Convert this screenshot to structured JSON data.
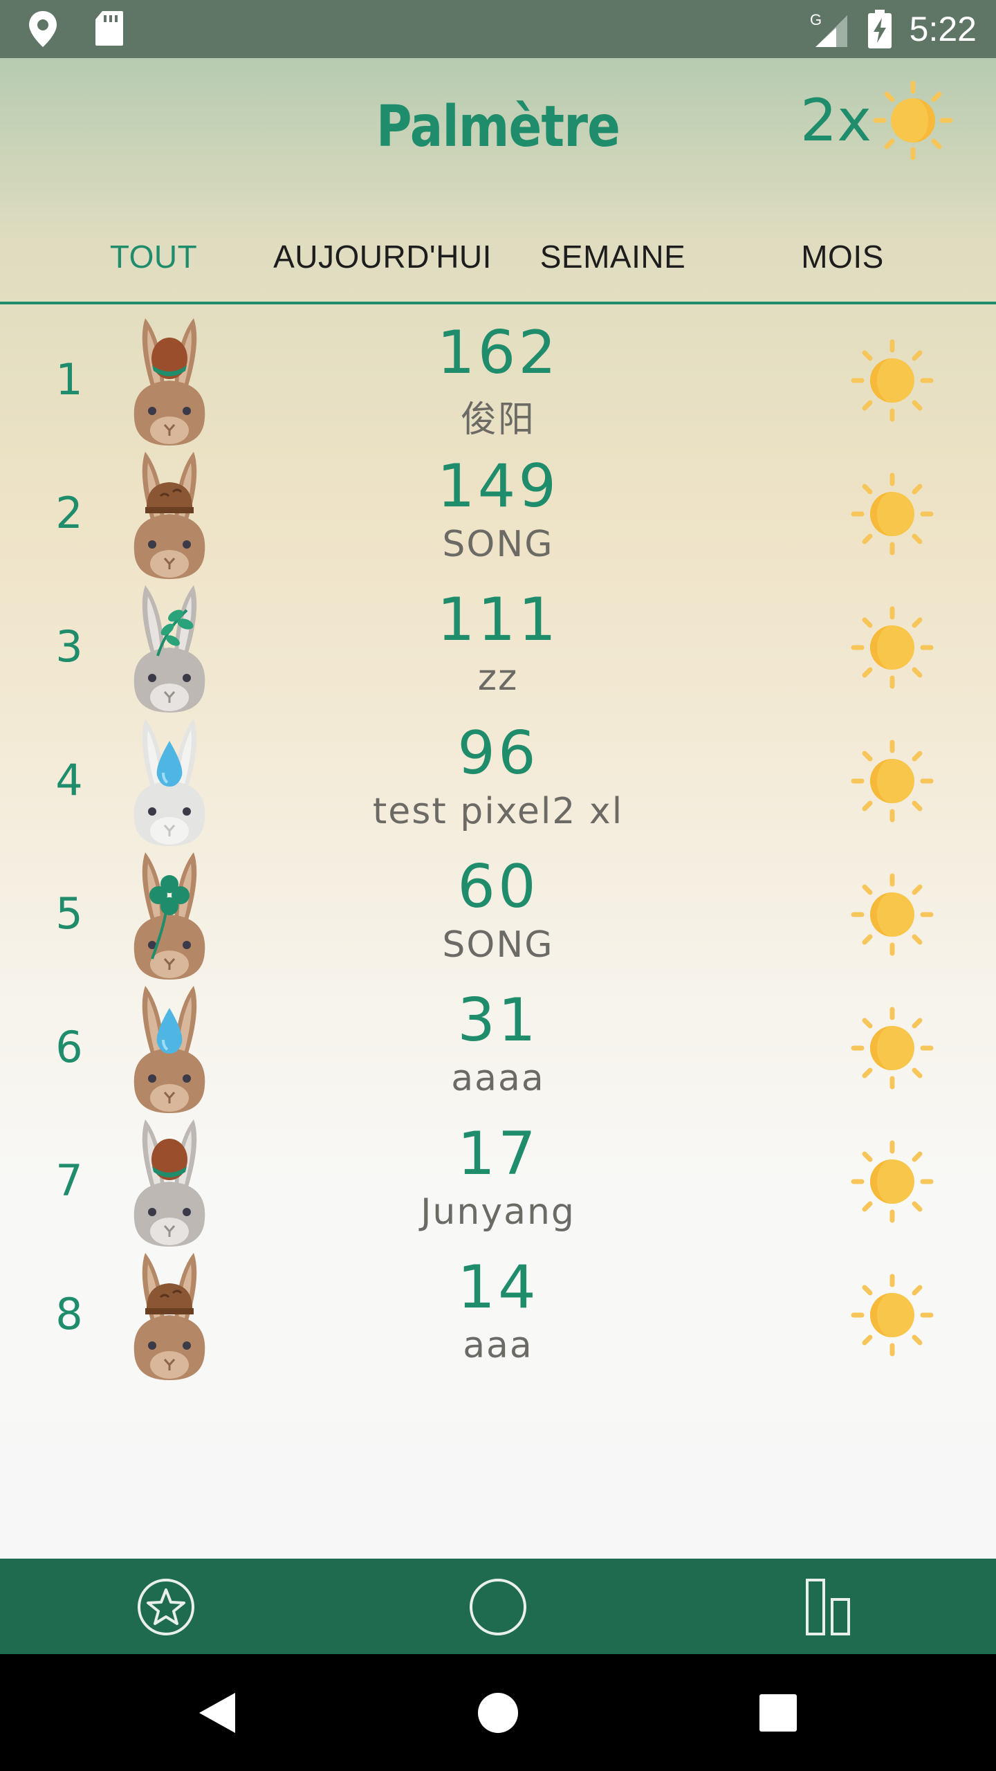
{
  "status_bar": {
    "time": "5:22",
    "network_label": "G",
    "icons": [
      "location-pin-icon",
      "sd-card-icon",
      "signal-icon",
      "battery-charging-icon"
    ]
  },
  "header": {
    "title": "Palmètre",
    "multiplier": "2x",
    "multiplier_icon": "sun-icon"
  },
  "tabs": [
    {
      "label": "TOUT",
      "active": true
    },
    {
      "label": "AUJOURD'HUI",
      "active": false
    },
    {
      "label": "SEMAINE",
      "active": false
    },
    {
      "label": "MOIS",
      "active": false
    }
  ],
  "leaderboard": [
    {
      "rank": "1",
      "score": "162",
      "name": "俊阳",
      "avatar": "brown-rabbit-acorn-hat-icon"
    },
    {
      "rank": "2",
      "score": "149",
      "name": "SONG",
      "avatar": "brown-rabbit-mushroom-hat-icon"
    },
    {
      "rank": "3",
      "score": "111",
      "name": "zz",
      "avatar": "grey-rabbit-leaf-icon"
    },
    {
      "rank": "4",
      "score": "96",
      "name": "test pixel2 xl",
      "avatar": "white-rabbit-water-drop-icon"
    },
    {
      "rank": "5",
      "score": "60",
      "name": "SONG",
      "avatar": "brown-rabbit-clover-icon"
    },
    {
      "rank": "6",
      "score": "31",
      "name": "aaaa",
      "avatar": "brown-rabbit-water-drop-icon"
    },
    {
      "rank": "7",
      "score": "17",
      "name": "Junyang",
      "avatar": "grey-rabbit-acorn-hat-icon"
    },
    {
      "rank": "8",
      "score": "14",
      "name": "aaa",
      "avatar": "brown-rabbit-mushroom-hat-icon"
    }
  ],
  "bottom_nav": {
    "items": [
      "star-badge-icon",
      "circle-icon",
      "bar-chart-icon"
    ]
  },
  "system_nav": {
    "items": [
      "back-icon",
      "home-icon",
      "recents-icon"
    ]
  },
  "colors": {
    "accent": "#1f8c6b",
    "nav_bg": "#1f6b50",
    "status_bg": "#5f7566",
    "sun": "#f5c542"
  }
}
